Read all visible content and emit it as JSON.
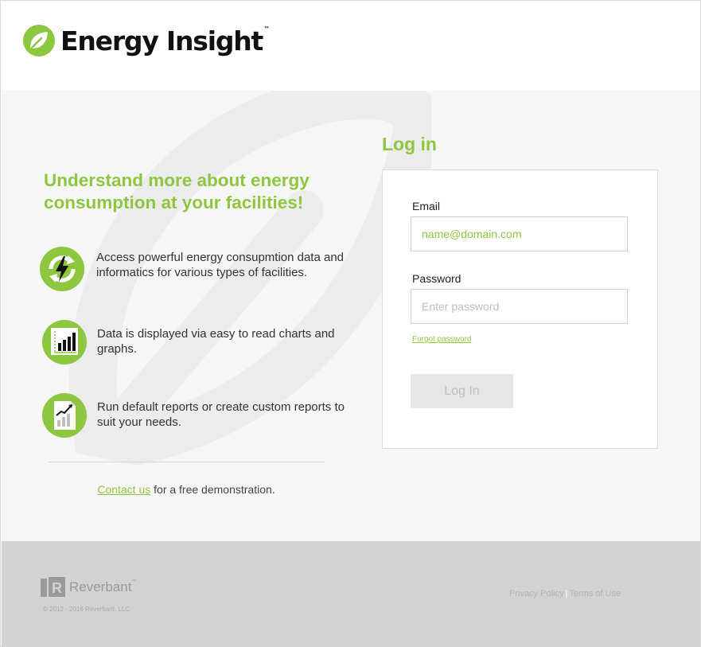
{
  "header": {
    "brand_name": "Energy Insight",
    "brand_tm": "™"
  },
  "hero": {
    "tagline": "Understand more about energy consumption at your facilities!",
    "features": [
      {
        "icon": "lightning-cycle-icon",
        "text": "Access powerful energy consupmtion data and informatics for various types of facilities."
      },
      {
        "icon": "bar-chart-icon",
        "text": "Data is displayed via easy to read charts and graphs."
      },
      {
        "icon": "report-icon",
        "text": "Run default reports or create custom reports to suit your needs."
      }
    ],
    "contact_link": "Contact us",
    "contact_rest": " for a free demonstration."
  },
  "login": {
    "title": "Log in",
    "email_label": "Email",
    "email_placeholder": "name@domain.com",
    "password_label": "Password",
    "password_placeholder": "Enter password",
    "forgot_label": "Forgot password",
    "button_label": "Log In"
  },
  "footer": {
    "company": "Reverbant",
    "company_tm": "™",
    "copyright": "© 2012 - 2016 Reverbant, LLC",
    "privacy": "Privacy Policy",
    "separator": "|",
    "terms": "Terms of Use"
  },
  "colors": {
    "accent": "#8dc63f",
    "footer_bg": "#d2d2d4",
    "main_bg": "#f6f6f6"
  }
}
